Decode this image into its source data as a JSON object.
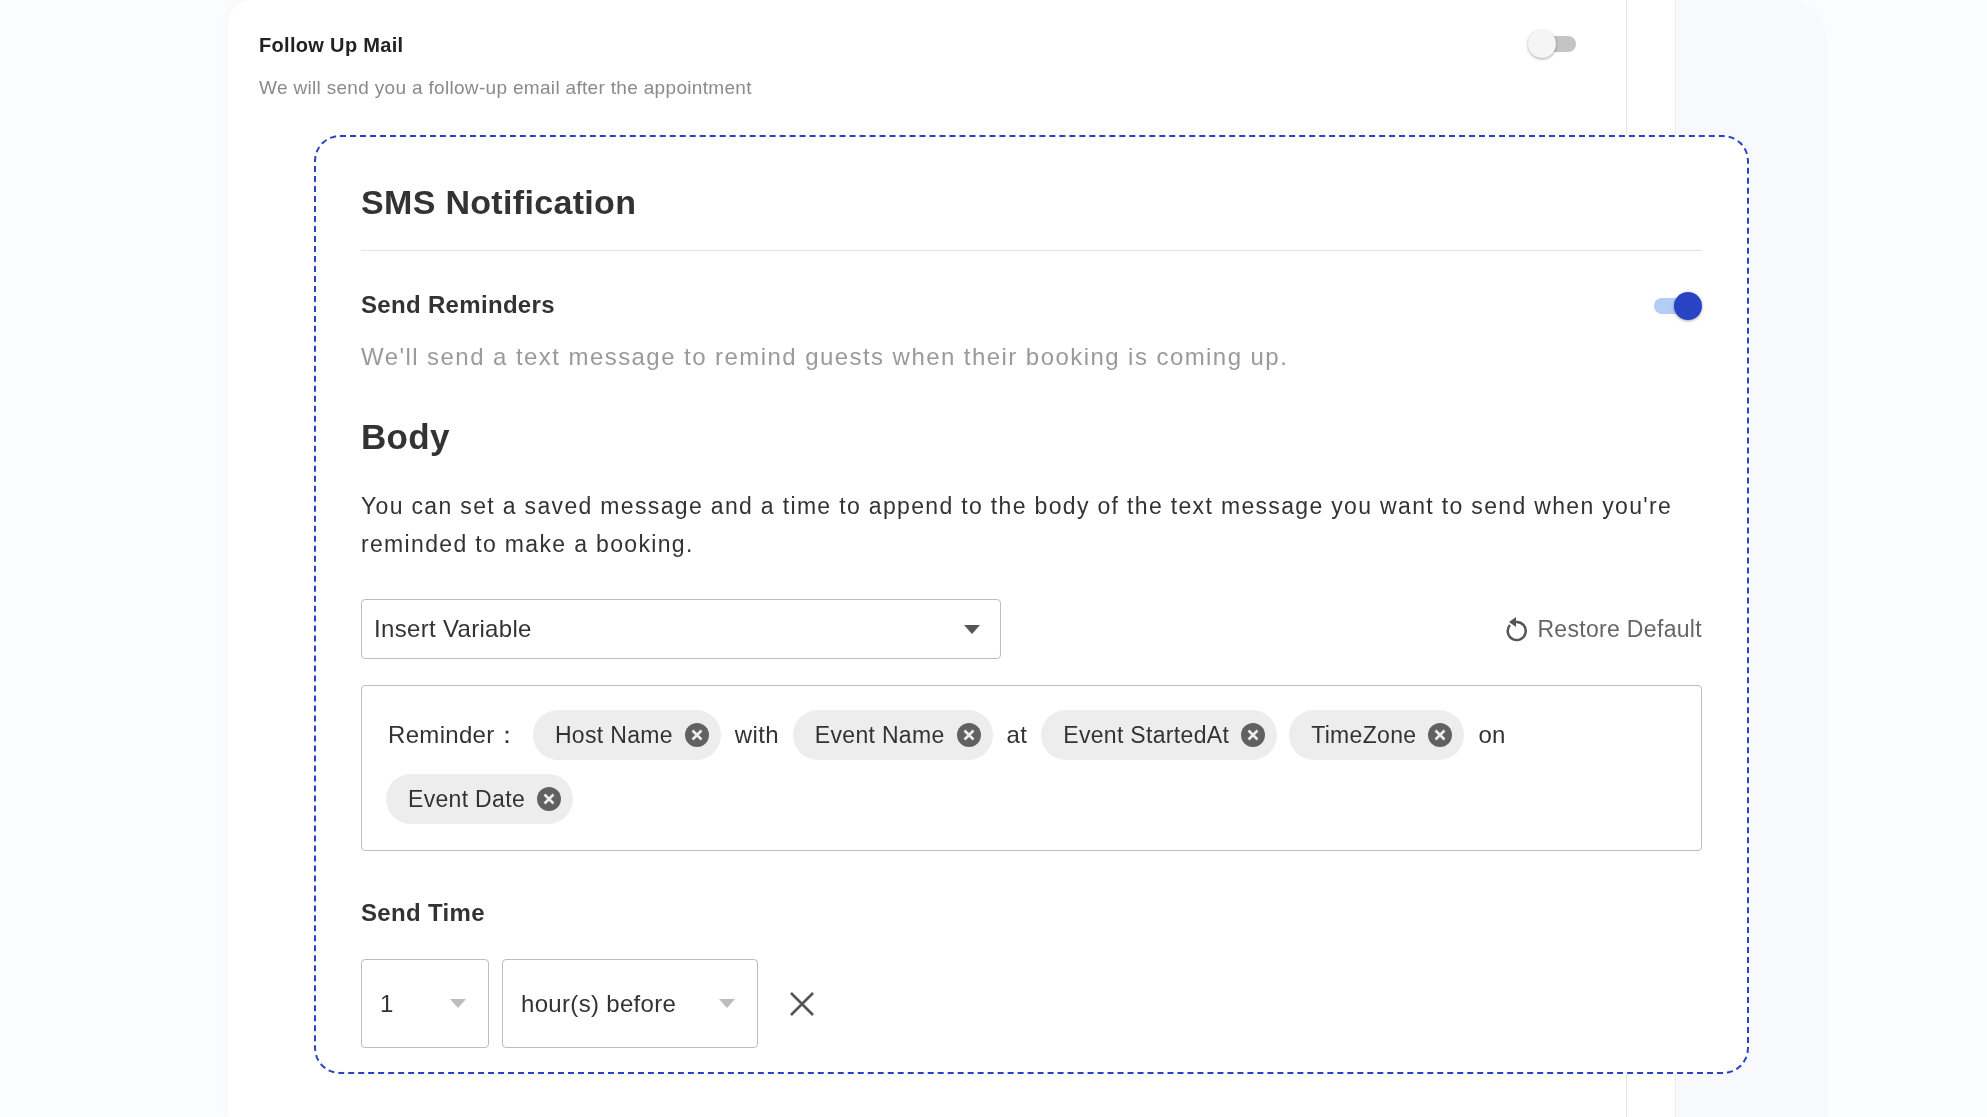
{
  "follow_up": {
    "title": "Follow Up Mail",
    "description": "We will send you a follow-up email after the appointment",
    "on": false
  },
  "sms": {
    "title": "SMS Notification",
    "send_reminders": {
      "title": "Send Reminders",
      "description": "We'll send a text message to remind guests when their booking is coming up.",
      "on": true
    },
    "body": {
      "heading": "Body",
      "description": "You can set a saved message and a time to append to the body of the text message you want to send when you're reminded to make a booking."
    },
    "insert_variable": {
      "value": "Insert Variable"
    },
    "restore_button": "Restore Default",
    "reminder": [
      {
        "kind": "text",
        "text": "Reminder："
      },
      {
        "kind": "chip",
        "text": "Host Name"
      },
      {
        "kind": "text",
        "text": "with"
      },
      {
        "kind": "chip",
        "text": "Event Name"
      },
      {
        "kind": "text",
        "text": "at"
      },
      {
        "kind": "chip",
        "text": "Event StartedAt"
      },
      {
        "kind": "chip",
        "text": "TimeZone"
      },
      {
        "kind": "text",
        "text": "on"
      },
      {
        "kind": "chip",
        "text": "Event Date"
      }
    ],
    "send_time": {
      "label": "Send Time",
      "amount": "1",
      "unit": "hour(s) before"
    }
  }
}
